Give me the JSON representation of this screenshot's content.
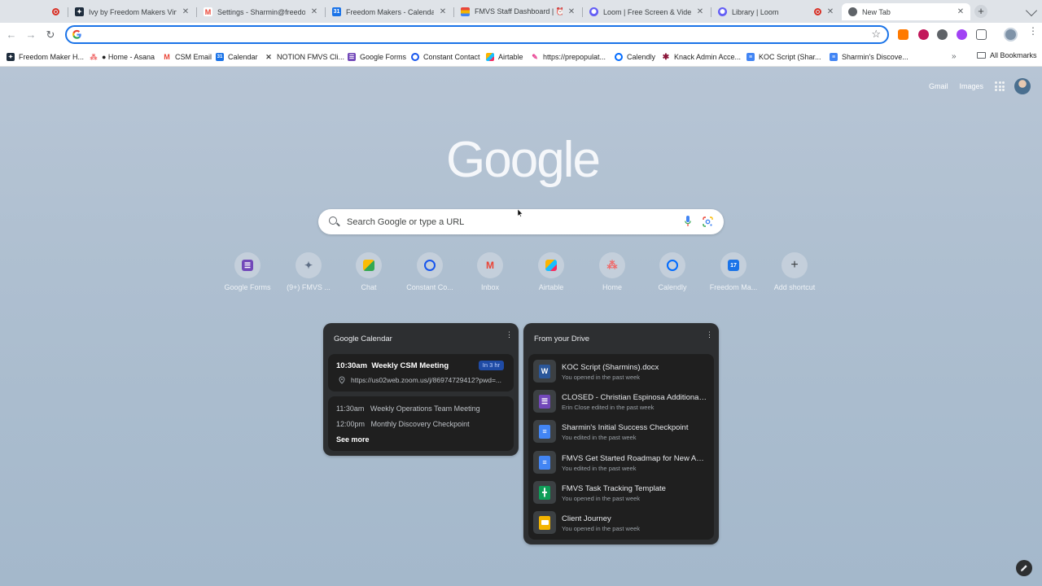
{
  "tabs": [
    {
      "title": "",
      "icon": "red-record-icon",
      "color": "#d93025",
      "has_close": false,
      "recording": false
    },
    {
      "title": "Ivy by Freedom Makers Virtual",
      "icon": "ivy-icon",
      "color": "#1f2d3d",
      "has_close": true
    },
    {
      "title": "Settings - Sharmin@freedom",
      "icon": "gmail-icon",
      "color": "#ea4335",
      "has_close": true
    },
    {
      "title": "Freedom Makers - Calendar",
      "icon": "calendar-icon",
      "color": "#1a73e8",
      "has_close": true
    },
    {
      "title": "FMVS Staff Dashboard | ⏰ T",
      "icon": "notion-stack-icon",
      "color": "#e8453c",
      "has_close": true
    },
    {
      "title": "Loom | Free Screen & Video R",
      "icon": "loom-icon",
      "color": "#625df5",
      "has_close": true
    },
    {
      "title": "Library | Loom",
      "icon": "loom-icon",
      "color": "#625df5",
      "has_close": true,
      "recording": true
    },
    {
      "title": "New Tab",
      "icon": "chrome-icon",
      "color": "#5f6368",
      "has_close": true,
      "active": true
    }
  ],
  "toolbar": {
    "omnibox_value": "",
    "omnibox_placeholder": ""
  },
  "bookmarks": [
    {
      "label": "Freedom Maker H...",
      "icon": "ivy-icon",
      "color": "#1f2d3d"
    },
    {
      "label": "● Home - Asana",
      "icon": "asana-icon",
      "color": "#f06a6a"
    },
    {
      "label": "CSM Email",
      "icon": "gmail-icon",
      "color": "#ea4335"
    },
    {
      "label": "Calendar",
      "icon": "calendar-icon",
      "color": "#1a73e8"
    },
    {
      "label": "NOTION FMVS Cli...",
      "icon": "notion-icon",
      "color": "#444"
    },
    {
      "label": "Google Forms",
      "icon": "forms-icon",
      "color": "#7248b9"
    },
    {
      "label": "Constant Contact",
      "icon": "constant-contact-icon",
      "color": "#1856ed"
    },
    {
      "label": "Airtable",
      "icon": "airtable-icon",
      "color": "#fcb400"
    },
    {
      "label": "https://prepopulat...",
      "icon": "link-icon",
      "color": "#e84393"
    },
    {
      "label": "Calendly",
      "icon": "calendly-icon",
      "color": "#006bff"
    },
    {
      "label": "Knack Admin Acce...",
      "icon": "knack-icon",
      "color": "#8a1538"
    },
    {
      "label": "KOC Script (Shar...",
      "icon": "docs-icon",
      "color": "#4285f4"
    },
    {
      "label": "Sharmin's Discove...",
      "icon": "docs-icon",
      "color": "#4285f4"
    }
  ],
  "all_bookmarks_label": "All Bookmarks",
  "ntp": {
    "gmail_label": "Gmail",
    "images_label": "Images",
    "logo_text": "Google",
    "search_placeholder": "Search Google or type a URL",
    "shortcuts": [
      {
        "label": "Google Forms",
        "icon": "forms-icon",
        "color": "#7248b9"
      },
      {
        "label": "(9+) FMVS ...",
        "icon": "notion-icon",
        "color": "#6b7a8f"
      },
      {
        "label": "Chat",
        "icon": "chat-icon",
        "color": "#34a853"
      },
      {
        "label": "Constant Co...",
        "icon": "constant-contact-icon",
        "color": "#1856ed"
      },
      {
        "label": "Inbox",
        "icon": "gmail-icon",
        "color": "#ea4335"
      },
      {
        "label": "Airtable",
        "icon": "airtable-icon",
        "color": "#fcb400"
      },
      {
        "label": "Home",
        "icon": "asana-icon",
        "color": "#f06a6a"
      },
      {
        "label": "Calendly",
        "icon": "calendly-icon",
        "color": "#006bff"
      },
      {
        "label": "Freedom Ma...",
        "icon": "calendar-icon",
        "color": "#1a73e8"
      },
      {
        "label": "Add shortcut",
        "icon": "plus-icon",
        "color": "#3c4043"
      }
    ],
    "calendar_card": {
      "title": "Google Calendar",
      "next_event": {
        "time": "10:30am",
        "title": "Weekly CSM Meeting",
        "badge": "In 3 hr",
        "location": "https://us02web.zoom.us/j/86974729412?pwd=..."
      },
      "upcoming": [
        {
          "time": "11:30am",
          "title": "Weekly Operations Team Meeting"
        },
        {
          "time": "12:00pm",
          "title": "Monthly Discovery Checkpoint"
        }
      ],
      "see_more": "See more"
    },
    "drive_card": {
      "title": "From your Drive",
      "files": [
        {
          "name": "KOC Script (Sharmins).docx",
          "sub": "You opened in the past week",
          "icon": "word-icon",
          "color": "#2b579a",
          "glyph": "W"
        },
        {
          "name": "CLOSED - Christian Espinosa Additional ...",
          "sub": "Erin Close edited in the past week",
          "icon": "forms-icon",
          "color": "#7248b9",
          "glyph": "☰"
        },
        {
          "name": "Sharmin's Initial Success Checkpoint",
          "sub": "You edited in the past week",
          "icon": "docs-icon",
          "color": "#4285f4",
          "glyph": "≡"
        },
        {
          "name": "FMVS Get Started Roadmap for New Assi...",
          "sub": "You edited in the past week",
          "icon": "docs-icon",
          "color": "#4285f4",
          "glyph": "≡"
        },
        {
          "name": "FMVS Task Tracking Template",
          "sub": "You opened in the past week",
          "icon": "sheets-icon",
          "color": "#0f9d58",
          "glyph": "╋"
        },
        {
          "name": "Client Journey",
          "sub": "You opened in the past week",
          "icon": "slides-icon",
          "color": "#f4b400",
          "glyph": "▬"
        }
      ]
    }
  }
}
